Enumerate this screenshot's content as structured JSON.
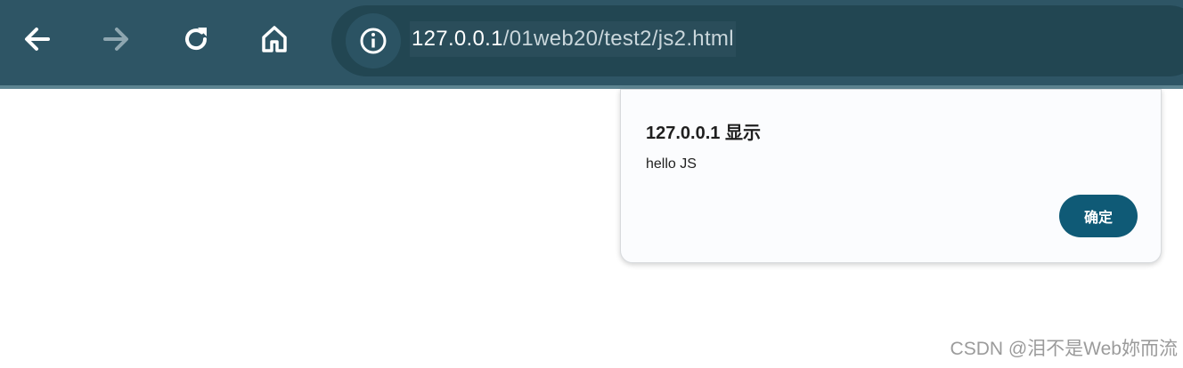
{
  "toolbar": {
    "back_icon": "arrow-left-icon",
    "forward_icon": "arrow-right-icon",
    "reload_icon": "reload-icon",
    "home_icon": "home-icon",
    "site_info_icon": "info-icon",
    "url_host": "127.0.0.1",
    "url_path": "/01web20/test2/js2.html"
  },
  "dialog": {
    "title": "127.0.0.1 显示",
    "message": "hello JS",
    "ok_label": "确定"
  },
  "watermark": {
    "text": "CSDN @泪不是Web妳而流"
  },
  "colors": {
    "toolbar_bg": "#2e5565",
    "omnibox_bg": "#224652",
    "button_accent": "#0f5a76"
  }
}
